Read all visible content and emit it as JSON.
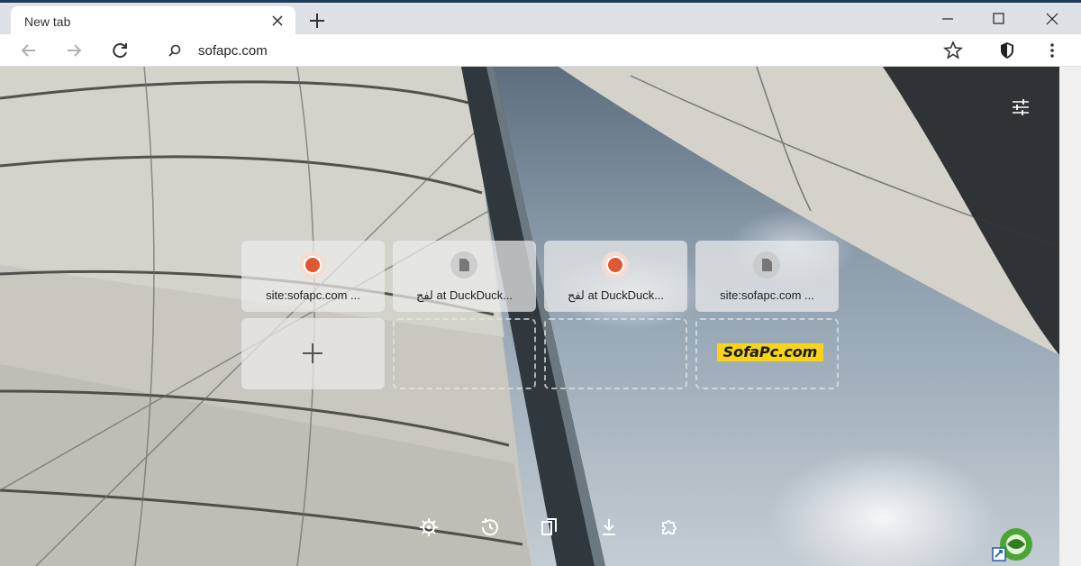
{
  "tab": {
    "title": "New tab"
  },
  "address_bar": {
    "url": "sofapc.com"
  },
  "tiles": [
    {
      "label": "site:sofapc.com ...",
      "icon": "duckduckgo-icon"
    },
    {
      "label": "لفح at DuckDuck...",
      "icon": "page-icon"
    },
    {
      "label": "لفح at DuckDuck...",
      "icon": "duckduckgo-icon"
    },
    {
      "label": "site:sofapc.com ...",
      "icon": "page-icon"
    }
  ],
  "sofapc_logo": {
    "text": "SofaPc.com"
  },
  "bottom_icons": [
    "settings-icon",
    "history-icon",
    "bookmarks-icon",
    "downloads-icon",
    "extensions-icon"
  ],
  "colors": {
    "ddg_orange": "#de5833",
    "sofapc_yellow": "#f7d31a",
    "tabstrip": "#dee1e6"
  }
}
